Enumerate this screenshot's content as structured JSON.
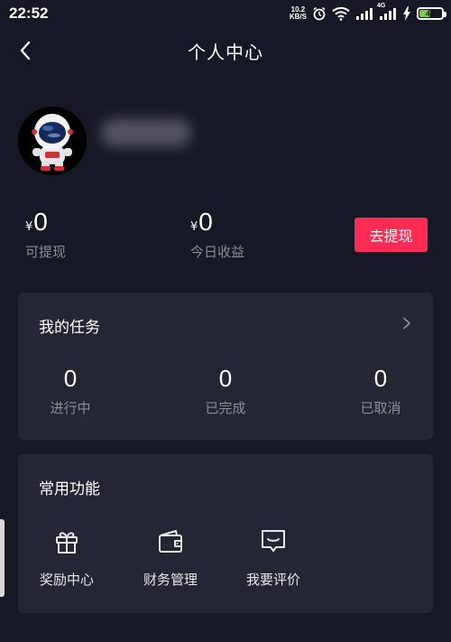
{
  "status_bar": {
    "time": "22:52",
    "net_speed_value": "10.2",
    "net_speed_unit": "KB/S",
    "network_type": "4G",
    "battery_level": "41",
    "icons": [
      "alarm-icon",
      "wifi-icon",
      "signal-icon",
      "charging-icon",
      "battery-icon"
    ]
  },
  "header": {
    "title": "个人中心",
    "back_icon": "chevron-left-icon"
  },
  "profile": {
    "avatar_icon": "astronaut-avatar"
  },
  "balance": {
    "withdrawable": {
      "currency": "¥",
      "amount": "0",
      "label": "可提现"
    },
    "today_income": {
      "currency": "¥",
      "amount": "0",
      "label": "今日收益"
    },
    "withdraw_button": "去提现"
  },
  "tasks": {
    "title": "我的任务",
    "items": [
      {
        "value": "0",
        "label": "进行中"
      },
      {
        "value": "0",
        "label": "已完成"
      },
      {
        "value": "0",
        "label": "已取消"
      }
    ]
  },
  "features": {
    "title": "常用功能",
    "items": [
      {
        "label": "奖励中心",
        "icon": "gift-icon"
      },
      {
        "label": "财务管理",
        "icon": "wallet-icon"
      },
      {
        "label": "我要评价",
        "icon": "comment-icon"
      }
    ]
  },
  "colors": {
    "background": "#171826",
    "card": "#252633",
    "accent": "#fe2c55",
    "muted_text": "#8a8c99"
  }
}
